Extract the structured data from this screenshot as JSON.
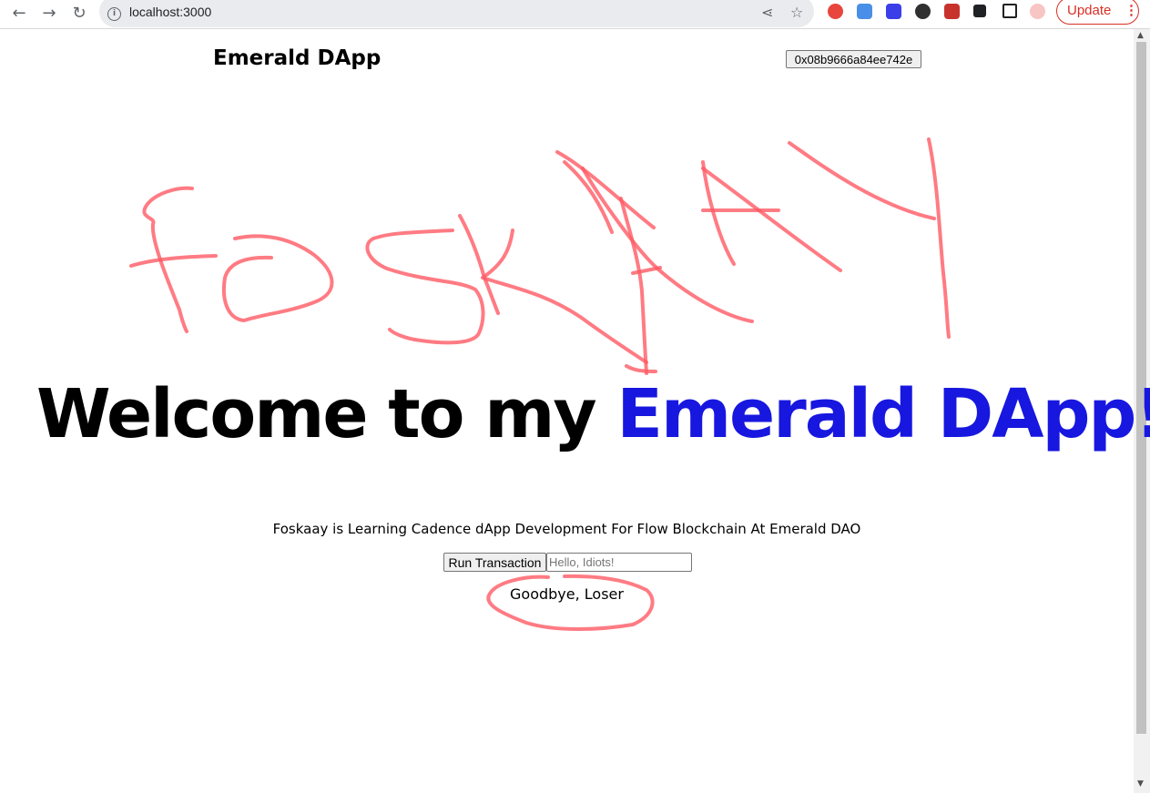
{
  "browser": {
    "url": "localhost:3000",
    "update_label": "Update",
    "menu_glyph": "⋮"
  },
  "header": {
    "brand": "Emerald DApp",
    "wallet_address": "0x08b9666a84ee742e"
  },
  "hero": {
    "title_prefix": "Welcome to my ",
    "title_highlight": "Emerald DApp!",
    "highlight_color": "#1717e0"
  },
  "tagline": "Foskaay is Learning Cadence dApp Development For Flow Blockchain At Emerald DAO",
  "transaction": {
    "button_label": "Run Transaction",
    "input_placeholder": "Hello, Idiots!",
    "input_value": ""
  },
  "greeting": "Goodbye, Loser",
  "annotation_color": "#ff5a64"
}
